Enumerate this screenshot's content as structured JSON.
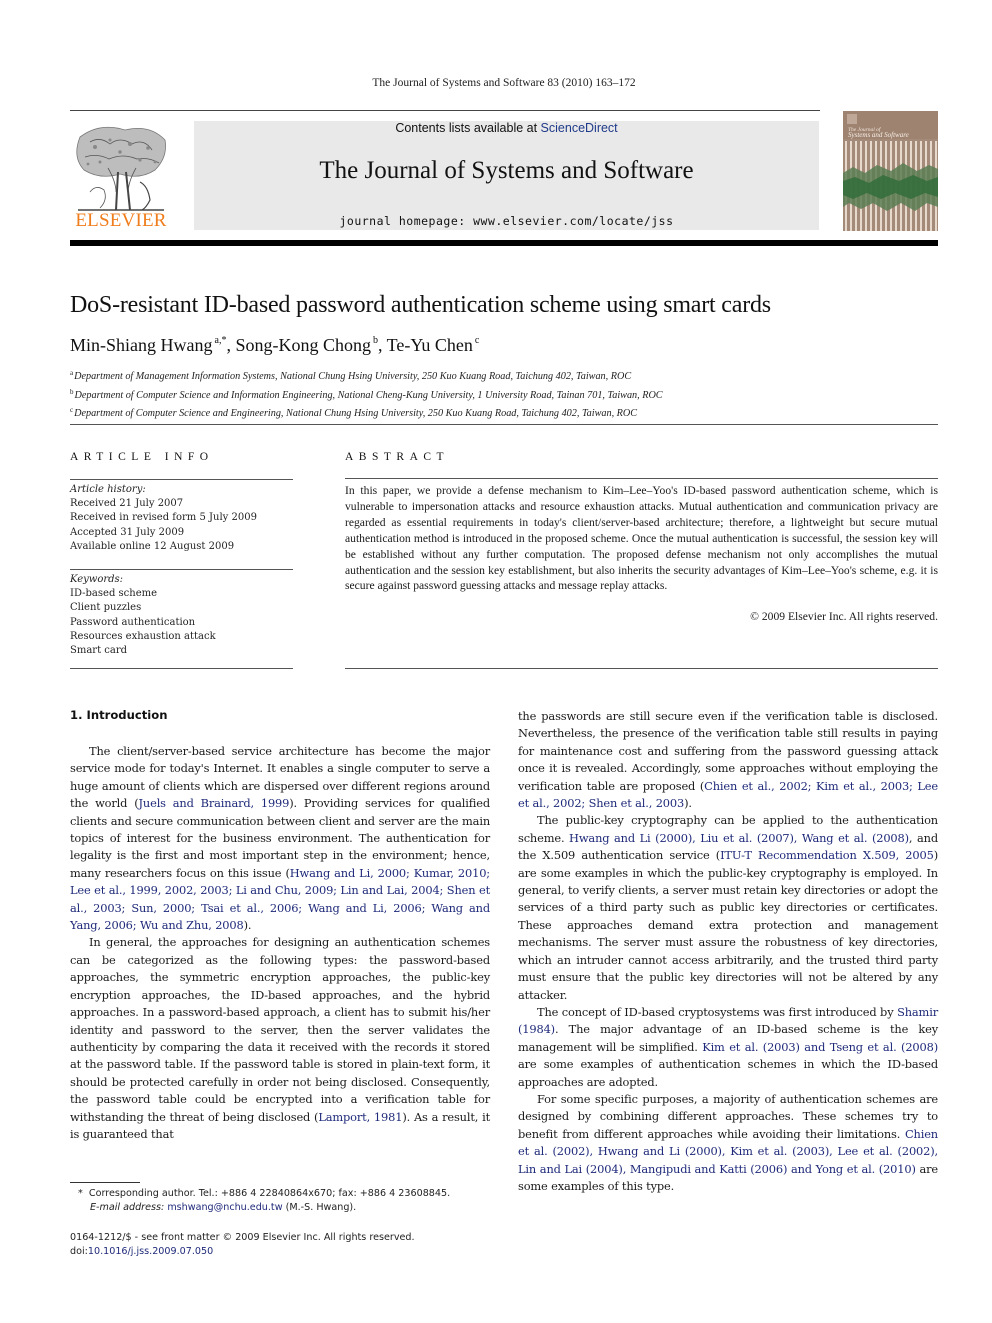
{
  "running_head": "The Journal of Systems and Software 83 (2010) 163–172",
  "banner": {
    "contents_prefix": "Contents lists available at ",
    "contents_link": "ScienceDirect",
    "journal_title": "The Journal of Systems and Software",
    "homepage": "journal homepage: www.elsevier.com/locate/jss",
    "publisher_logo_text": "ELSEVIER",
    "cover_title_line1": "The Journal of",
    "cover_title_line2": "Systems and Software",
    "brand_color": "#f07d1b",
    "banner_bg": "#e9e9e9"
  },
  "article": {
    "title": "DoS-resistant ID-based password authentication scheme using smart cards",
    "authors": [
      {
        "name": "Min-Shiang Hwang",
        "marks": "a,*",
        "sep": ", "
      },
      {
        "name": "Song-Kong Chong",
        "marks": "b",
        "sep": ", "
      },
      {
        "name": "Te-Yu Chen",
        "marks": "c",
        "sep": ""
      }
    ],
    "affiliations": [
      {
        "mark": "a",
        "text": "Department of Management Information Systems, National Chung Hsing University, 250 Kuo Kuang Road, Taichung 402, Taiwan, ROC"
      },
      {
        "mark": "b",
        "text": "Department of Computer Science and Information Engineering, National Cheng-Kung University, 1 University Road, Tainan 701, Taiwan, ROC"
      },
      {
        "mark": "c",
        "text": "Department of Computer Science and Engineering, National Chung Hsing University, 250 Kuo Kuang Road, Taichung 402, Taiwan, ROC"
      }
    ]
  },
  "article_info": {
    "heading": "ARTICLE INFO",
    "history_label": "Article history:",
    "history": [
      "Received 21 July 2007",
      "Received in revised form 5 July 2009",
      "Accepted 31 July 2009",
      "Available online 12 August 2009"
    ],
    "keywords_label": "Keywords:",
    "keywords": [
      "ID-based scheme",
      "Client puzzles",
      "Password authentication",
      "Resources exhaustion attack",
      "Smart card"
    ]
  },
  "abstract": {
    "heading": "ABSTRACT",
    "text": "In this paper, we provide a defense mechanism to Kim–Lee–Yoo's ID-based password authentication scheme, which is vulnerable to impersonation attacks and resource exhaustion attacks. Mutual authentication and communication privacy are regarded as essential requirements in today's client/server-based architecture; therefore, a lightweight but secure mutual authentication method is introduced in the proposed scheme. Once the mutual authentication is successful, the session key will be established without any further computation. The proposed defense mechanism not only accomplishes the mutual authentication and the session key establishment, but also inherits the security advantages of Kim–Lee–Yoo's scheme, e.g. it is secure against password guessing attacks and message replay attacks.",
    "copyright": "© 2009 Elsevier Inc. All rights reserved."
  },
  "introduction": {
    "heading": "1. Introduction",
    "left_paragraphs": [
      [
        {
          "t": "The client/server-based service architecture has become the major service mode for today's Internet. It enables a single computer to serve a huge amount of clients which are dispersed over different regions around the world ("
        },
        {
          "t": "Juels and Brainard, 1999",
          "link": true
        },
        {
          "t": "). Providing services for qualified clients and secure communication between client and server are the main topics of interest for the business environment. The authentication for legality is the first and most important step in the environment; hence, many researchers focus on this issue ("
        },
        {
          "t": "Hwang and Li, 2000; Kumar, 2010; Lee et al., 1999, 2002, 2003; Li and Chu, 2009; Lin and Lai, 2004; Shen et al., 2003; Sun, 2000; Tsai et al., 2006; Wang and Li, 2006; Wang and Yang, 2006; Wu and Zhu, 2008",
          "link": true
        },
        {
          "t": ")."
        }
      ],
      [
        {
          "t": "In general, the approaches for designing an authentication schemes can be categorized as the following types: the password-based approaches, the symmetric encryption approaches, the public-key encryption approaches, the ID-based approaches, and the hybrid approaches. In a password-based approach, a client has to submit his/her identity and password to the server, then the server validates the authenticity by comparing the data it received with the records it stored at the password table. If the password table is stored in plain-text form, it should be protected carefully in order not being disclosed. Consequently, the password table could be encrypted into a verification table for withstanding the threat of being disclosed ("
        },
        {
          "t": "Lamport, 1981",
          "link": true
        },
        {
          "t": "). As a result, it is guaranteed that"
        }
      ]
    ],
    "right_paragraphs": [
      [
        {
          "t": "the passwords are still secure even if the verification table is disclosed. Nevertheless, the presence of the verification table still results in paying for maintenance cost and suffering from the password guessing attack once it is revealed. Accordingly, some approaches without employing the verification table are proposed ("
        },
        {
          "t": "Chien et al., 2002; Kim et al., 2003; Lee et al., 2002; Shen et al., 2003",
          "link": true
        },
        {
          "t": ")."
        }
      ],
      [
        {
          "t": "The public-key cryptography can be applied to the authentication scheme. "
        },
        {
          "t": "Hwang and Li (2000), Liu et al. (2007), Wang et al. (2008)",
          "link": true
        },
        {
          "t": ", and the X.509 authentication service ("
        },
        {
          "t": "ITU-T Recommendation X.509, 2005",
          "link": true
        },
        {
          "t": ") are some examples in which the public-key cryptography is employed. In general, to verify clients, a server must retain key directories or adopt the services of a third party such as public key directories or certificates. These approaches demand extra protection and management mechanisms. The server must assure the robustness of key directories, which an intruder cannot access arbitrarily, and the trusted third party must ensure that the public key directories will not be altered by any attacker."
        }
      ],
      [
        {
          "t": "The concept of ID-based cryptosystems was first introduced by "
        },
        {
          "t": "Shamir (1984)",
          "link": true
        },
        {
          "t": ". The major advantage of an ID-based scheme is the key management will be simplified. "
        },
        {
          "t": "Kim et al. (2003) and Tseng et al. (2008)",
          "link": true
        },
        {
          "t": " are some examples of authentication schemes in which the ID-based approaches are adopted."
        }
      ],
      [
        {
          "t": "For some specific purposes, a majority of authentication schemes are designed by combining different approaches. These schemes try to benefit from different approaches while avoiding their limitations. "
        },
        {
          "t": "Chien et al. (2002), Hwang and Li (2000), Kim et al. (2003), Lee et al. (2002), Lin and Lai (2004), Mangipudi and Katti (2006) and Yong et al. (2010)",
          "link": true
        },
        {
          "t": " are some examples of this type."
        }
      ]
    ]
  },
  "footnote": {
    "marker": "*",
    "line1": "Corresponding author. Tel.: +886 4 22840864x670; fax: +886 4 23608845.",
    "email_label": "E-mail address:",
    "email": "mshwang@nchu.edu.tw",
    "email_suffix": " (M.-S. Hwang)."
  },
  "front_matter": {
    "issn_line": "0164-1212/$ - see front matter © 2009 Elsevier Inc. All rights reserved.",
    "doi_label": "doi:",
    "doi": "10.1016/j.jss.2009.07.050"
  },
  "link_color": "#1f2a7a"
}
